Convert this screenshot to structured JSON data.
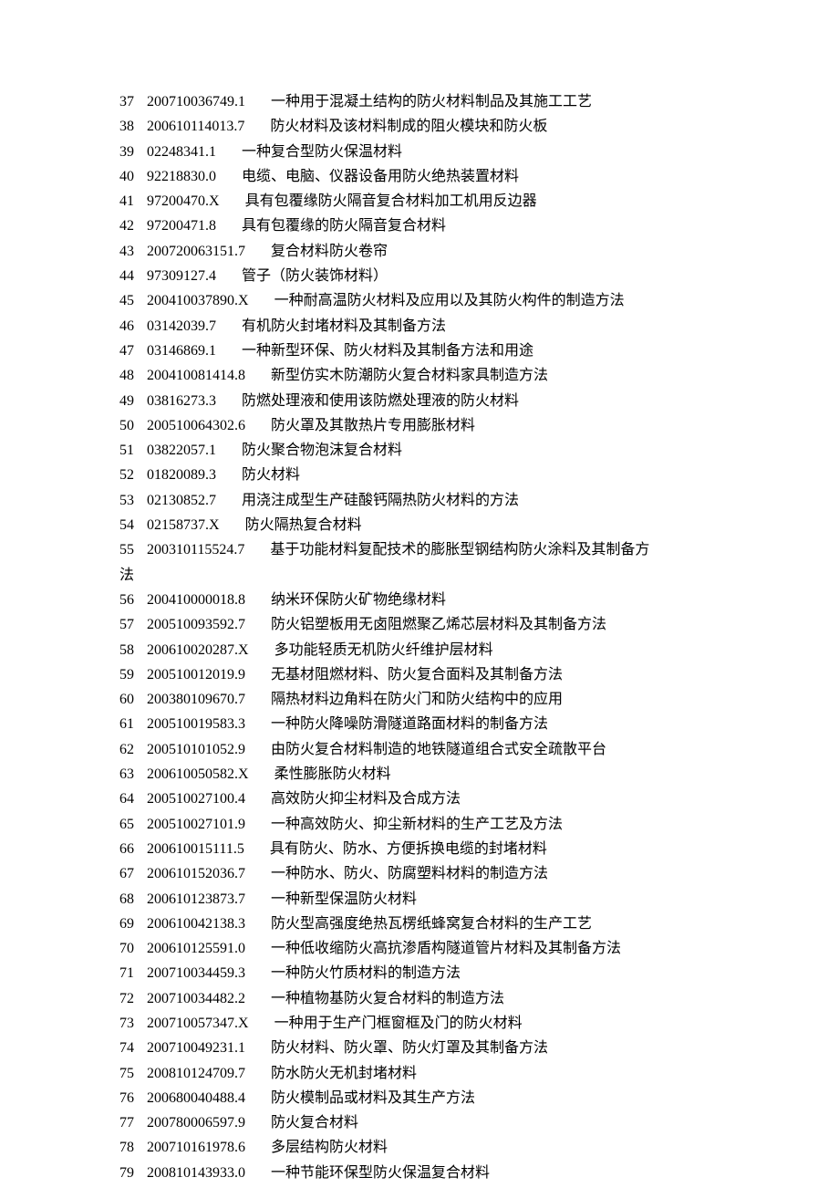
{
  "rows": [
    {
      "n": "37",
      "p": "200710036749.1",
      "t": "一种用于混凝土结构的防火材料制品及其施工工艺"
    },
    {
      "n": "38",
      "p": "200610114013.7",
      "t": "防火材料及该材料制成的阻火模块和防火板"
    },
    {
      "n": "39",
      "p": "02248341.1",
      "t": "一种复合型防火保温材料"
    },
    {
      "n": "40",
      "p": "92218830.0",
      "t": "电缆、电脑、仪器设备用防火绝热装置材料"
    },
    {
      "n": "41",
      "p": "97200470.X",
      "t": "具有包覆缘防火隔音复合材料加工机用反边器"
    },
    {
      "n": "42",
      "p": "97200471.8",
      "t": "具有包覆缘的防火隔音复合材料"
    },
    {
      "n": "43",
      "p": "200720063151.7",
      "t": "复合材料防火卷帘"
    },
    {
      "n": "44",
      "p": "97309127.4",
      "t": "管子（防火装饰材料）"
    },
    {
      "n": "45",
      "p": "200410037890.X",
      "t": "一种耐高温防火材料及应用以及其防火构件的制造方法"
    },
    {
      "n": "46",
      "p": "03142039.7",
      "t": "有机防火封堵材料及其制备方法"
    },
    {
      "n": "47",
      "p": "03146869.1",
      "t": "一种新型环保、防火材料及其制备方法和用途"
    },
    {
      "n": "48",
      "p": "200410081414.8",
      "t": "新型仿实木防潮防火复合材料家具制造方法"
    },
    {
      "n": "49",
      "p": "03816273.3",
      "t": "防燃处理液和使用该防燃处理液的防火材料"
    },
    {
      "n": "50",
      "p": "200510064302.6",
      "t": "防火罩及其散热片专用膨胀材料"
    },
    {
      "n": "51",
      "p": "03822057.1",
      "t": "防火聚合物泡沫复合材料"
    },
    {
      "n": "52",
      "p": "01820089.3",
      "t": "防火材料"
    },
    {
      "n": "53",
      "p": "02130852.7",
      "t": "用浇注成型生产硅酸钙隔热防火材料的方法"
    },
    {
      "n": "54",
      "p": "02158737.X",
      "t": "防火隔热复合材料"
    },
    {
      "n": "55",
      "p": "200310115524.7",
      "t": "基于功能材料复配技术的膨胀型钢结构防火涂料及其制备方",
      "wrap": "法"
    },
    {
      "n": "56",
      "p": "200410000018.8",
      "t": "纳米环保防火矿物绝缘材料"
    },
    {
      "n": "57",
      "p": "200510093592.7",
      "t": "防火铝塑板用无卤阻燃聚乙烯芯层材料及其制备方法"
    },
    {
      "n": "58",
      "p": "200610020287.X",
      "t": "多功能轻质无机防火纤维护层材料"
    },
    {
      "n": "59",
      "p": "200510012019.9",
      "t": "无基材阻燃材料、防火复合面料及其制备方法"
    },
    {
      "n": "60",
      "p": "200380109670.7",
      "t": "隔热材料边角料在防火门和防火结构中的应用"
    },
    {
      "n": "61",
      "p": "200510019583.3",
      "t": "一种防火降噪防滑隧道路面材料的制备方法"
    },
    {
      "n": "62",
      "p": "200510101052.9",
      "t": "由防火复合材料制造的地铁隧道组合式安全疏散平台"
    },
    {
      "n": "63",
      "p": "200610050582.X",
      "t": "柔性膨胀防火材料"
    },
    {
      "n": "64",
      "p": "200510027100.4",
      "t": "高效防火抑尘材料及合成方法"
    },
    {
      "n": "65",
      "p": "200510027101.9",
      "t": "一种高效防火、抑尘新材料的生产工艺及方法"
    },
    {
      "n": "66",
      "p": "200610015111.5",
      "t": "具有防火、防水、方便拆换电缆的封堵材料"
    },
    {
      "n": "67",
      "p": "200610152036.7",
      "t": "一种防水、防火、防腐塑料材料的制造方法"
    },
    {
      "n": "68",
      "p": "200610123873.7",
      "t": "一种新型保温防火材料"
    },
    {
      "n": "69",
      "p": "200610042138.3",
      "t": "防火型高强度绝热瓦楞纸蜂窝复合材料的生产工艺"
    },
    {
      "n": "70",
      "p": "200610125591.0",
      "t": "一种低收缩防火高抗渗盾构隧道管片材料及其制备方法"
    },
    {
      "n": "71",
      "p": "200710034459.3",
      "t": "一种防火竹质材料的制造方法"
    },
    {
      "n": "72",
      "p": "200710034482.2",
      "t": "一种植物基防火复合材料的制造方法"
    },
    {
      "n": "73",
      "p": "200710057347.X",
      "t": "一种用于生产门框窗框及门的防火材料"
    },
    {
      "n": "74",
      "p": "200710049231.1",
      "t": "防火材料、防火罩、防火灯罩及其制备方法"
    },
    {
      "n": "75",
      "p": "200810124709.7",
      "t": "防水防火无机封堵材料"
    },
    {
      "n": "76",
      "p": "200680040488.4",
      "t": "防火模制品或材料及其生产方法"
    },
    {
      "n": "77",
      "p": "200780006597.9",
      "t": "防火复合材料"
    },
    {
      "n": "78",
      "p": "200710161978.6",
      "t": "多层结构防火材料"
    },
    {
      "n": "79",
      "p": "200810143933.0",
      "t": "一种节能环保型防火保温复合材料"
    }
  ]
}
